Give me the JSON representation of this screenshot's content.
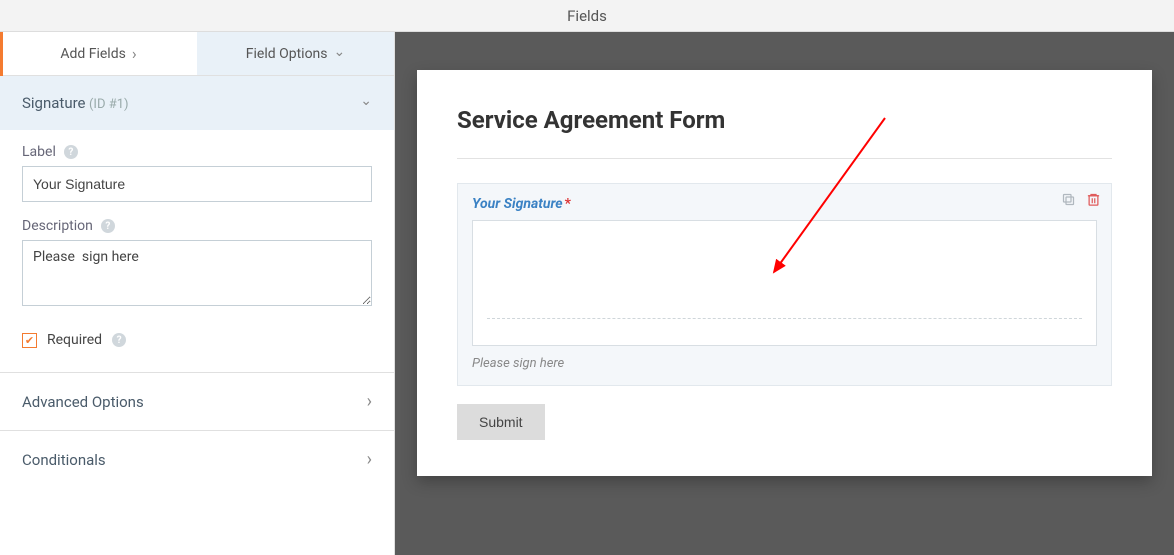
{
  "header": {
    "title": "Fields"
  },
  "tabs": {
    "add_fields": "Add Fields",
    "field_options": "Field Options"
  },
  "editor": {
    "field_type": "Signature",
    "field_id": "(ID #1)",
    "label_label": "Label",
    "label_value": "Your Signature",
    "description_label": "Description",
    "description_value": "Please  sign here",
    "required_label": "Required"
  },
  "accordion": {
    "advanced": "Advanced Options",
    "conditionals": "Conditionals"
  },
  "preview": {
    "form_title": "Service Agreement Form",
    "signature_label": "Your Signature",
    "signature_description": "Please sign here",
    "submit_label": "Submit"
  }
}
